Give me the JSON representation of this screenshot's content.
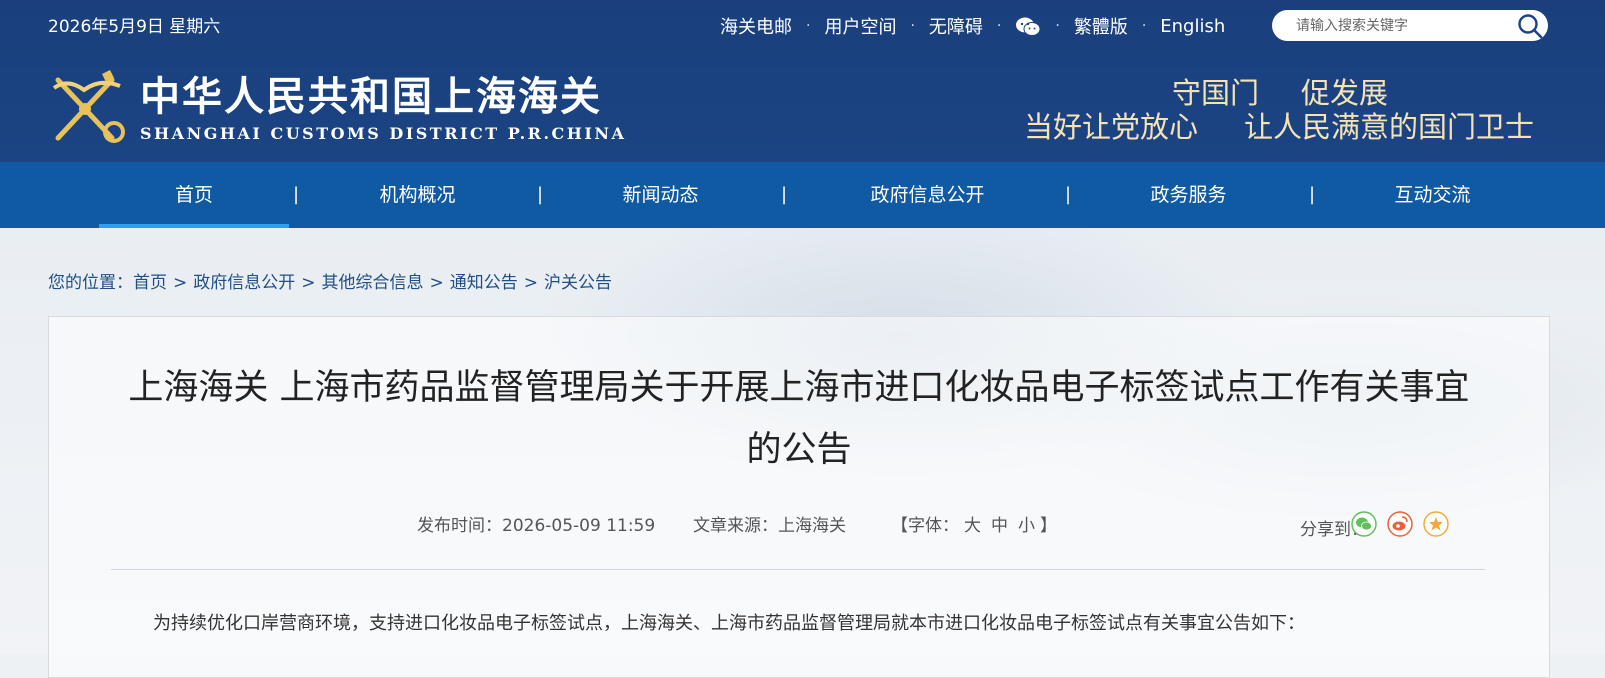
{
  "header": {
    "date": "2026年5月9日 星期六",
    "links": [
      "海关电邮",
      "用户空间",
      "无障碍",
      "繁體版",
      "English"
    ],
    "search_placeholder": "请输入搜索关键字",
    "logo_cn": "中华人民共和国上海海关",
    "logo_en": "SHANGHAI CUSTOMS DISTRICT P.R.CHINA",
    "slogan_line1": [
      "守国门",
      "促发展"
    ],
    "slogan_line2": [
      "当好让党放心",
      "让人民满意的国门卫士"
    ]
  },
  "nav": {
    "items": [
      "首页",
      "机构概况",
      "新闻动态",
      "政府信息公开",
      "政务服务",
      "互动交流"
    ],
    "separator": "|",
    "active": 0
  },
  "breadcrumb": {
    "label": "您的位置：",
    "items": [
      "首页",
      "政府信息公开",
      "其他综合信息",
      "通知公告",
      "沪关公告"
    ],
    "separator": ">"
  },
  "article": {
    "title_line1": "上海海关 上海市药品监督管理局关于开展上海市进口化妆品电子标签试点工作有关事宜",
    "title_line2": "的公告",
    "publish_time_label": "发布时间：",
    "publish_time": "2026-05-09 11:59",
    "source_label": "文章来源：",
    "source": "上海海关",
    "font_label_open": "【字体：",
    "font_sizes": [
      "大",
      "中",
      "小"
    ],
    "font_label_close": "】",
    "share_label": "分享到：",
    "share_targets": [
      "wechat-icon",
      "weibo-icon",
      "favorite-icon"
    ],
    "first_paragraph": "为持续优化口岸营商环境，支持进口化妆品电子标签试点，上海海关、上海市药品监督管理局就本市进口化妆品电子标签试点有关事宜公告如下："
  },
  "colors": {
    "header_bg": "#1a3f7c",
    "nav_bg": "#0f5aa3",
    "nav_active_underline": "#2ea0f2",
    "slogan": "#f6e3b4",
    "breadcrumb": "#1f4f86"
  }
}
